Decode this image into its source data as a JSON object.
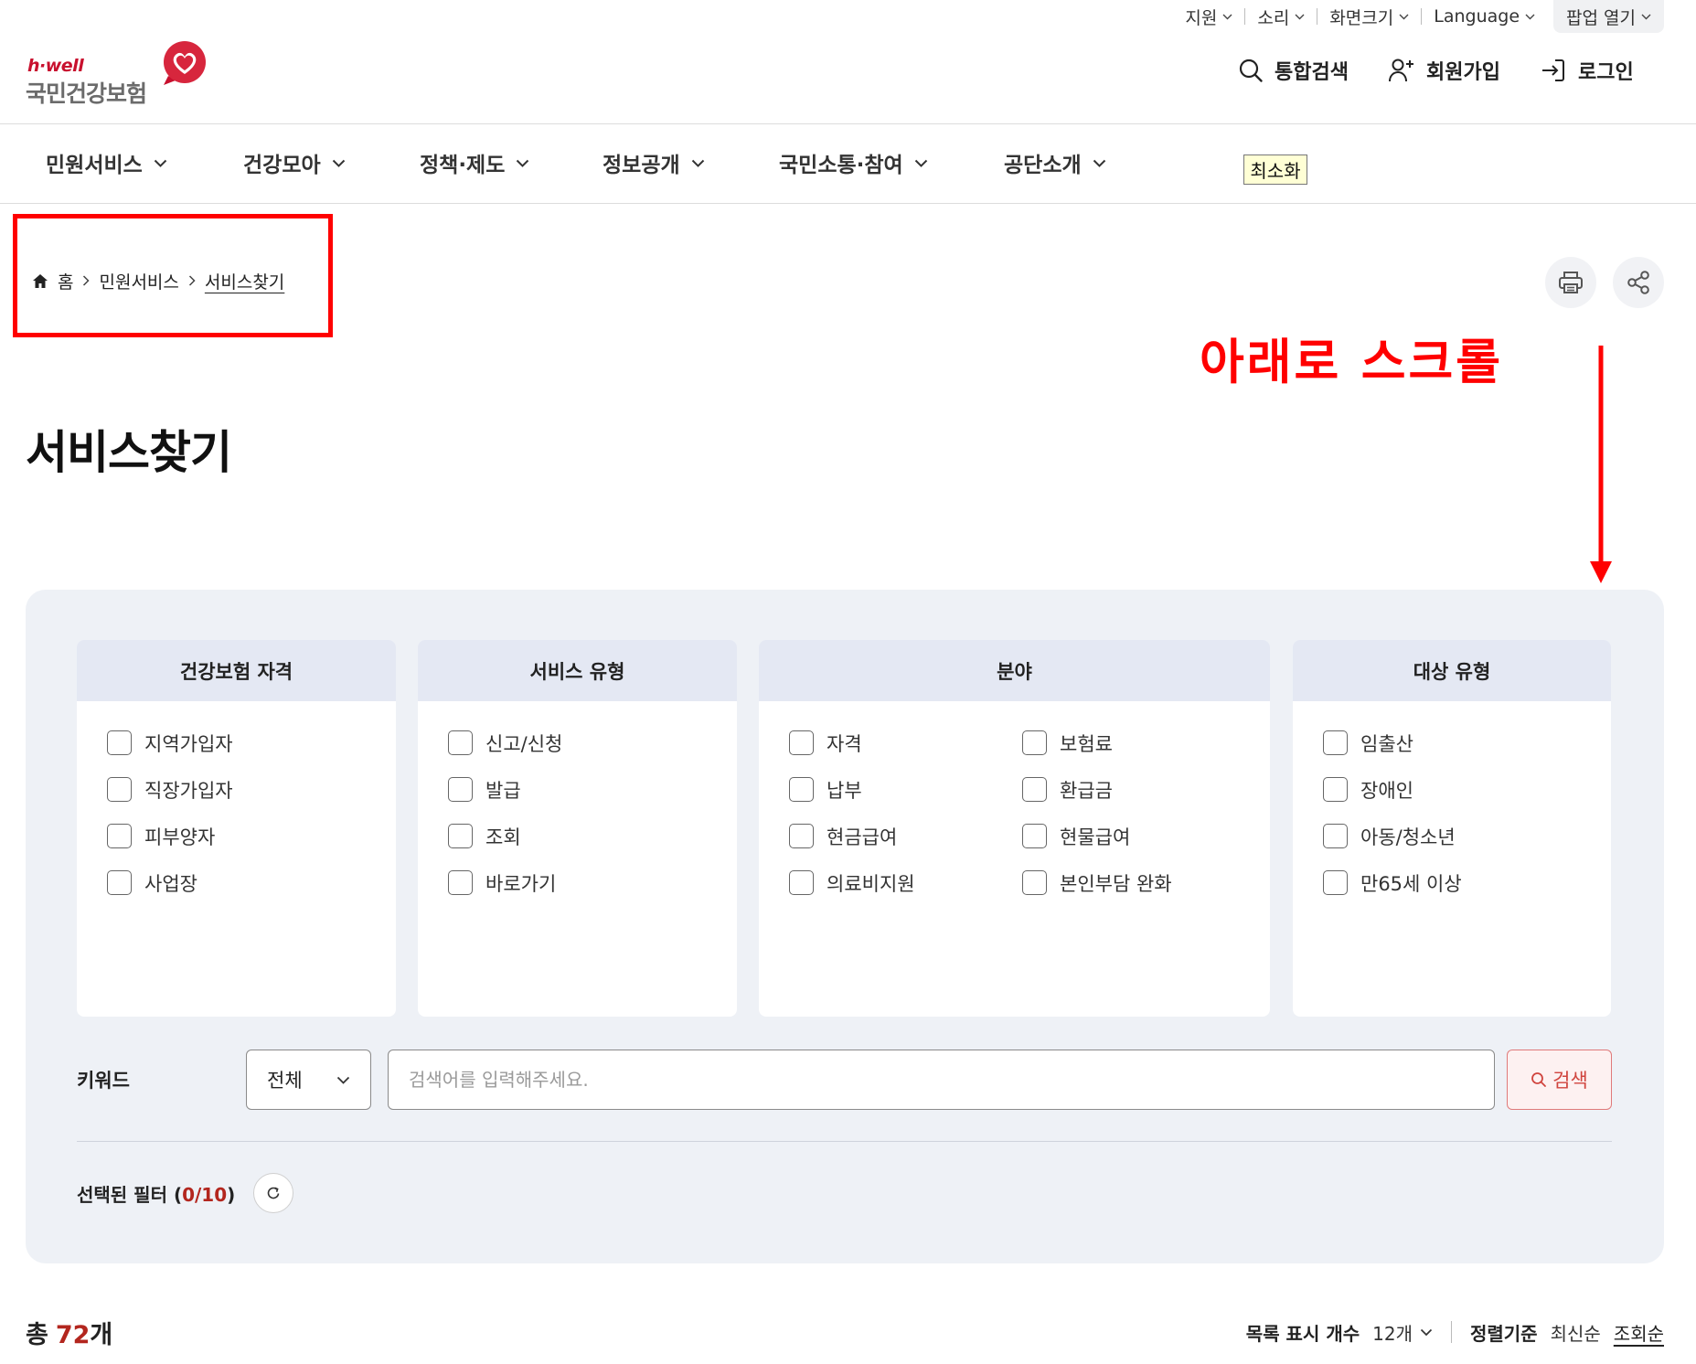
{
  "utility_bar": {
    "items": [
      "지원",
      "소리",
      "화면크기",
      "Language",
      "팝업 열기"
    ]
  },
  "logo": {
    "brand": "h·well",
    "name": "국민건강보험"
  },
  "header": {
    "search_label": "통합검색",
    "signup_label": "회원가입",
    "login_label": "로그인"
  },
  "nav": {
    "items": [
      "민원서비스",
      "건강모아",
      "정책·제도",
      "정보공개",
      "국민소통·참여",
      "공단소개"
    ],
    "minimize_label": "최소화"
  },
  "breadcrumb": {
    "home": "홈",
    "items": [
      "민원서비스",
      "서비스찾기"
    ]
  },
  "annotation": {
    "text": "아래로 스크롤",
    "color": "#ff0000"
  },
  "page_title": "서비스찾기",
  "filters": {
    "groups": [
      {
        "title": "건강보험 자격",
        "options": [
          "지역가입자",
          "직장가입자",
          "피부양자",
          "사업장"
        ]
      },
      {
        "title": "서비스 유형",
        "options": [
          "신고/신청",
          "발급",
          "조회",
          "바로가기"
        ]
      },
      {
        "title": "분야",
        "options": [
          "자격",
          "보험료",
          "납부",
          "환급금",
          "현금급여",
          "현물급여",
          "의료비지원",
          "본인부담 완화"
        ]
      },
      {
        "title": "대상 유형",
        "options": [
          "임출산",
          "장애인",
          "아동/청소년",
          "만65세 이상"
        ]
      }
    ]
  },
  "keyword": {
    "label": "키워드",
    "scope_selected": "전체",
    "placeholder": "검색어를 입력해주세요.",
    "button_label": "검색"
  },
  "selected_filters": {
    "label": "선택된 필터",
    "open": "(",
    "count": "0/10",
    "close": ")"
  },
  "results": {
    "total_prefix": "총",
    "total_count": "72",
    "total_suffix": "개",
    "page_size_label": "목록 표시 개수",
    "page_size_value": "12개",
    "sort_label": "정렬기준",
    "sort_options": [
      "최신순",
      "조회순"
    ],
    "active_sort_index": 1
  },
  "colors": {
    "brand_red": "#c8102e",
    "accent_red": "#b3261e",
    "search_button_red": "#d0443e",
    "panel_bg": "#eef1f6",
    "group_header_bg": "#e4e8f3",
    "annotation_red": "#ff0000"
  },
  "icons": {
    "dropdown": "chevron-down-icon",
    "search": "search-icon",
    "signup": "user-plus-icon",
    "login": "login-icon",
    "home": "home-icon",
    "breadcrumb_separator": "chevron-right-icon",
    "print": "print-icon",
    "share": "share-icon",
    "reset": "refresh-icon",
    "logo_mark": "heart-icon"
  }
}
